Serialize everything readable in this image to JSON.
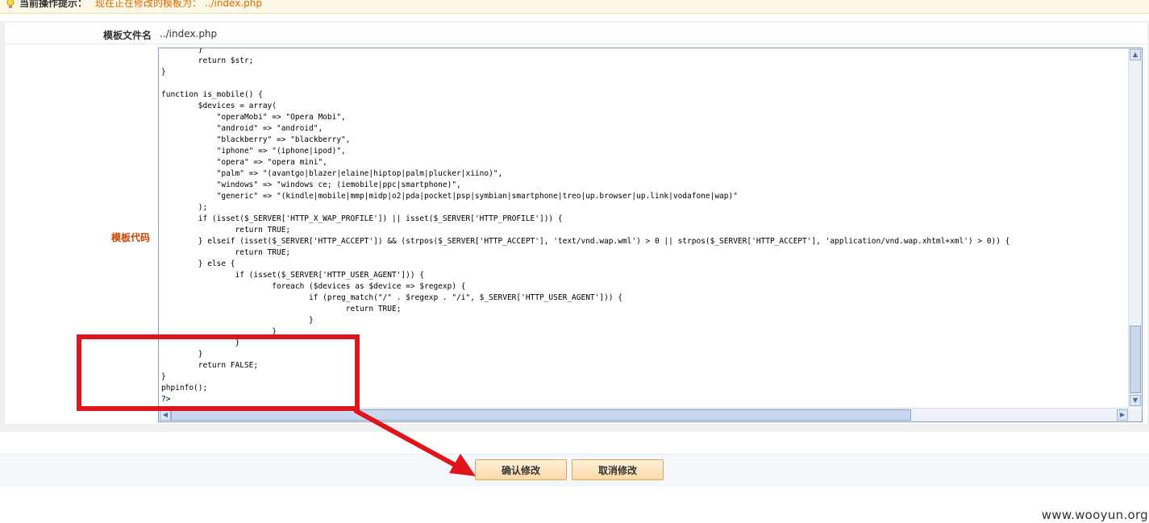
{
  "tip": {
    "icon": "lightbulb-icon",
    "label": "当前操作提示：",
    "message": "现在正在修改的模板为：  ../index.php"
  },
  "form": {
    "filename_label": "模板文件名",
    "filename_value": "../index.php",
    "code_label": "模板代码",
    "code": "        }\n        return $str;\n}\n\nfunction is_mobile() {\n        $devices = array(\n            \"operaMobi\" => \"Opera Mobi\",\n            \"android\" => \"android\",\n            \"blackberry\" => \"blackberry\",\n            \"iphone\" => \"(iphone|ipod)\",\n            \"opera\" => \"opera mini\",\n            \"palm\" => \"(avantgo|blazer|elaine|hiptop|palm|plucker|xiino)\",\n            \"windows\" => \"windows ce; (iemobile|ppc|smartphone)\",\n            \"generic\" => \"(kindle|mobile|mmp|midp|o2|pda|pocket|psp|symbian|smartphone|treo|up.browser|up.link|vodafone|wap)\"\n        );\n        if (isset($_SERVER['HTTP_X_WAP_PROFILE']) || isset($_SERVER['HTTP_PROFILE'])) {\n                return TRUE;\n        } elseif (isset($_SERVER['HTTP_ACCEPT']) && (strpos($_SERVER['HTTP_ACCEPT'], 'text/vnd.wap.wml') > 0 || strpos($_SERVER['HTTP_ACCEPT'], 'application/vnd.wap.xhtml+xml') > 0)) {\n                return TRUE;\n        } else {\n                if (isset($_SERVER['HTTP_USER_AGENT'])) {\n                        foreach ($devices as $device => $regexp) {\n                                if (preg_match(\"/\" . $regexp . \"/i\", $_SERVER['HTTP_USER_AGENT'])) {\n                                        return TRUE;\n                                }\n                        }\n                }\n        }\n        return FALSE;\n}\nphpinfo();\n?>"
  },
  "buttons": {
    "confirm": "确认修改",
    "cancel": "取消修改"
  },
  "annotation": {
    "highlight_color": "#e0141b"
  },
  "watermark": "www.wooyun.org"
}
